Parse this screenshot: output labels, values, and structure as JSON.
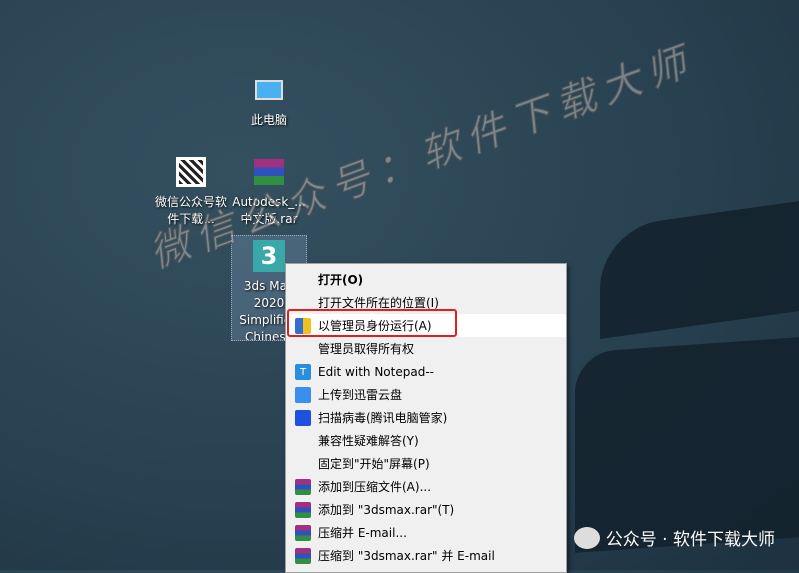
{
  "desktop_icons": [
    {
      "label": "此电脑"
    },
    {
      "label": "微信公众号软件下载..."
    },
    {
      "label": "Autodesk_...中文版.rar"
    },
    {
      "label": "3ds Max 2020 Simplified Chinese"
    }
  ],
  "context_menu": [
    {
      "label": "打开(O)",
      "icon": ""
    },
    {
      "label": "打开文件所在的位置(I)",
      "icon": ""
    },
    {
      "label": "以管理员身份运行(A)",
      "icon": "shield-icon"
    },
    {
      "label": "管理员取得所有权",
      "icon": ""
    },
    {
      "label": "Edit with Notepad--",
      "icon": "notepad-icon"
    },
    {
      "label": "上传到迅雷云盘",
      "icon": "thunder-icon"
    },
    {
      "label": "扫描病毒(腾讯电脑管家)",
      "icon": "tencent-shield-icon"
    },
    {
      "label": "兼容性疑难解答(Y)",
      "icon": ""
    },
    {
      "label": "固定到\"开始\"屏幕(P)",
      "icon": ""
    },
    {
      "label": "添加到压缩文件(A)...",
      "icon": "winrar-icon"
    },
    {
      "label": "添加到 \"3dsmax.rar\"(T)",
      "icon": "winrar-icon"
    },
    {
      "label": "压缩并 E-mail...",
      "icon": "winrar-icon"
    },
    {
      "label": "压缩到 \"3dsmax.rar\" 并 E-mail",
      "icon": "winrar-icon"
    }
  ],
  "watermark": "微信公众号：软件下载大师",
  "footer": "公众号 · 软件下载大师"
}
